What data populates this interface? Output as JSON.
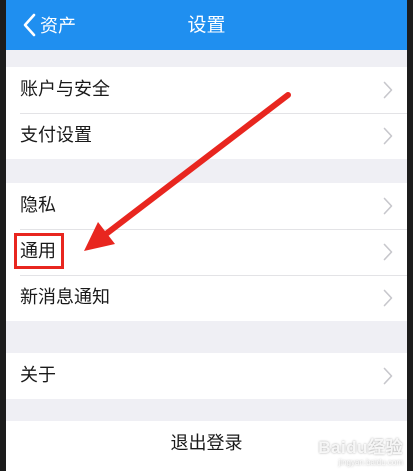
{
  "nav": {
    "back_label": "资产",
    "title": "设置",
    "background_color": "#1f8ff0"
  },
  "groups": [
    {
      "items": [
        {
          "label": "账户与安全"
        },
        {
          "label": "支付设置"
        }
      ]
    },
    {
      "items": [
        {
          "label": "隐私"
        },
        {
          "label": "通用",
          "highlighted": true
        },
        {
          "label": "新消息通知"
        }
      ]
    },
    {
      "items": [
        {
          "label": "关于"
        }
      ]
    }
  ],
  "logout": {
    "label": "退出登录"
  },
  "annotation": {
    "arrow_color": "#e8261f",
    "highlight_color": "#e8261f"
  },
  "watermark": {
    "brand": "Baidu经验",
    "url": "jingyan.baidu.com"
  }
}
